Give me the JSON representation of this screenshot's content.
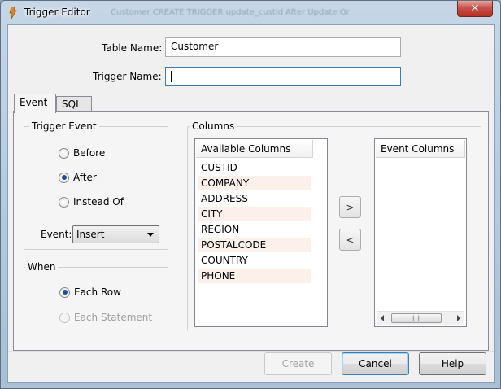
{
  "window": {
    "title": "Trigger Editor",
    "background_title": "Customer      CREATE TRIGGER update_custid  After Update  Or",
    "close_symbol": "✕"
  },
  "form": {
    "table_name_label": "Table Name:",
    "table_name_value": "Customer",
    "trigger_name_label_pre": "Trigger ",
    "trigger_name_label_mnemonic": "N",
    "trigger_name_label_post": "ame:",
    "trigger_name_value": ""
  },
  "tabs": [
    {
      "label": "Event",
      "active": true
    },
    {
      "label": "SQL",
      "active": false
    }
  ],
  "trigger_event": {
    "title": "Trigger Event",
    "options": [
      {
        "label": "Before",
        "selected": false
      },
      {
        "label": "After",
        "selected": true
      },
      {
        "label": "Instead Of",
        "selected": false
      }
    ],
    "event_label": "Event:",
    "event_value": "Insert"
  },
  "when": {
    "title": "When",
    "options": [
      {
        "label": "Each Row",
        "selected": true,
        "enabled": true
      },
      {
        "label": "Each Statement",
        "selected": false,
        "enabled": false
      }
    ]
  },
  "columns": {
    "title": "Columns",
    "available_header": "Available Columns",
    "available": [
      "CUSTID",
      "COMPANY",
      "ADDRESS",
      "CITY",
      "REGION",
      "POSTALCODE",
      "COUNTRY",
      "PHONE"
    ],
    "event_header": "Event Columns",
    "add_label": ">",
    "remove_label": "<",
    "scroll_grip": "|||"
  },
  "buttons": {
    "create": "Create",
    "cancel": "Cancel",
    "help": "Help"
  }
}
